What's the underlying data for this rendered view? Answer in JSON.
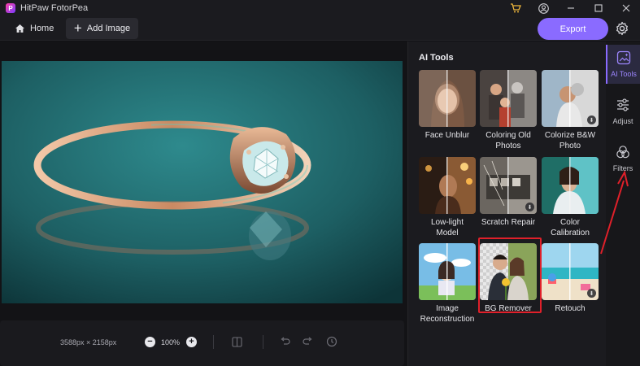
{
  "window": {
    "app_logo_letter": "P",
    "title": "HitPaw FotorPea",
    "controls": [
      "cart-icon",
      "account-icon",
      "minimize-icon",
      "maximize-icon",
      "close-icon"
    ]
  },
  "toolbar": {
    "home_label": "Home",
    "add_image_label": "Add Image",
    "export_label": "Export",
    "accent_color": "#8a6bff"
  },
  "canvas": {
    "image_subject": "rose gold ring with diamond on teal reflective surface",
    "dimensions": "3588px × 2158px",
    "zoom": "100%"
  },
  "ai_tools": {
    "title": "AI Tools",
    "items": [
      {
        "label": "Face Unblur",
        "downloadable": false
      },
      {
        "label": "Coloring Old Photos",
        "downloadable": false
      },
      {
        "label": "Colorize B&W Photo",
        "downloadable": true
      },
      {
        "label": "Low-light Model",
        "downloadable": false
      },
      {
        "label": "Scratch Repair",
        "downloadable": true
      },
      {
        "label": "Color Calibration",
        "downloadable": false
      },
      {
        "label": "Image Reconstruction",
        "downloadable": false
      },
      {
        "label": "BG Remover",
        "downloadable": false,
        "highlighted": true
      },
      {
        "label": "Retouch",
        "downloadable": true
      }
    ]
  },
  "rail": {
    "items": [
      {
        "label": "AI Tools",
        "icon": "ai-tools-icon",
        "active": true
      },
      {
        "label": "Adjust",
        "icon": "sliders-icon",
        "active": false
      },
      {
        "label": "Filters",
        "icon": "filters-icon",
        "active": false
      }
    ]
  },
  "annotation": {
    "highlight_color": "#e0202a"
  }
}
